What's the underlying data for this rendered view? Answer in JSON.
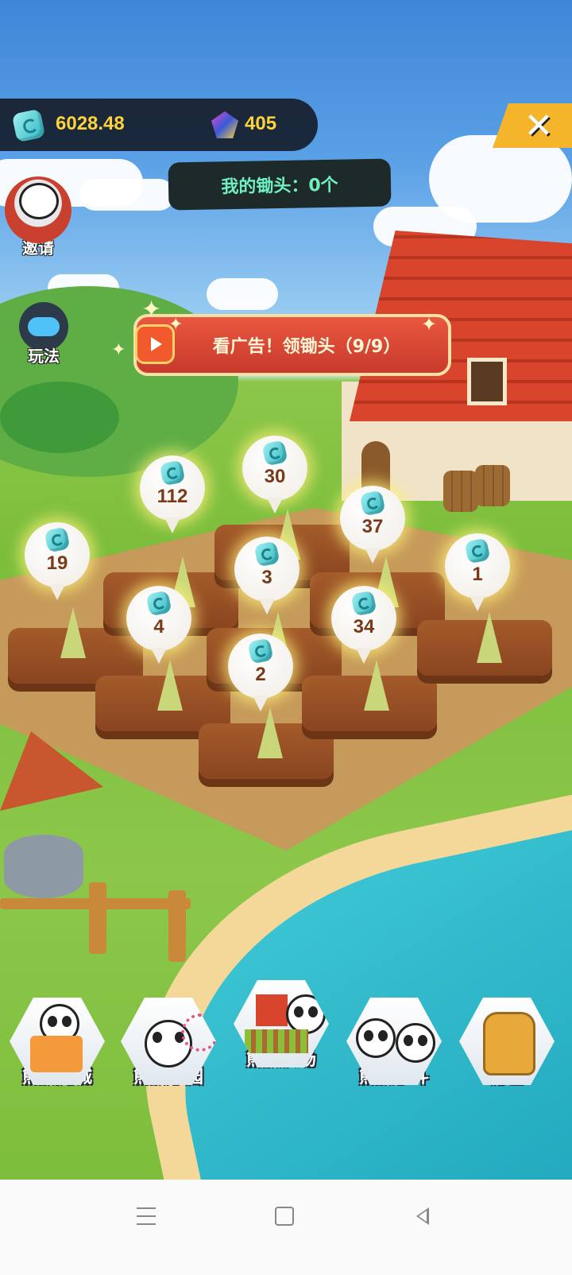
{
  "currency": {
    "gem_amount": "6028.48",
    "diamond_amount": "405"
  },
  "close_label": "✕",
  "hoe_banner": {
    "text": "我的锄头：0个"
  },
  "side_buttons": {
    "invite_label": "邀请",
    "howto_label": "玩法"
  },
  "ad_banner": {
    "text": "看广告！领锄头（9/9）"
  },
  "bubbles": [
    {
      "value": "112"
    },
    {
      "value": "30"
    },
    {
      "value": "19"
    },
    {
      "value": "37"
    },
    {
      "value": "3"
    },
    {
      "value": "1"
    },
    {
      "value": "4"
    },
    {
      "value": "34"
    },
    {
      "value": "2"
    }
  ],
  "bottom_nav": [
    {
      "label": "熊猫商城",
      "icon": "panda-shop-icon"
    },
    {
      "label": "熊猫乐园",
      "icon": "panda-park-icon"
    },
    {
      "label": "熊猫农场",
      "icon": "panda-farm-icon"
    },
    {
      "label": "熊猫争斗",
      "icon": "panda-fight-icon"
    },
    {
      "label": "背包",
      "icon": "backpack-icon"
    }
  ],
  "colors": {
    "accent_gold": "#ffd23a",
    "banner_red": "#d9452c",
    "hoe_text": "#6ff0c0"
  }
}
